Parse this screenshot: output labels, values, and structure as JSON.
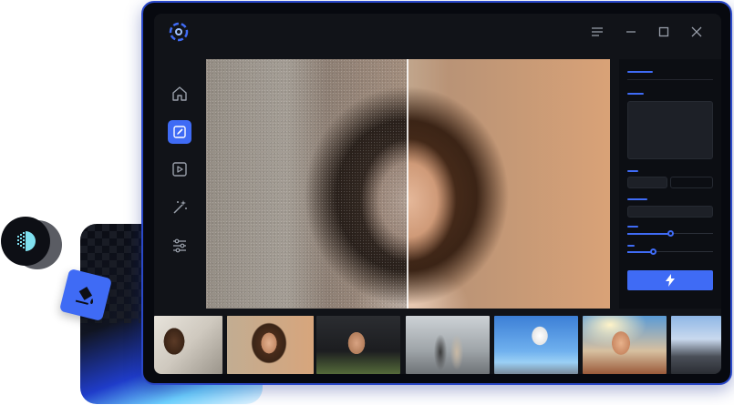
{
  "app": {
    "logo_icon": "aperture-logo-icon",
    "window_controls": [
      {
        "name": "menu-icon"
      },
      {
        "name": "minimize-icon"
      },
      {
        "name": "maximize-icon"
      },
      {
        "name": "close-icon"
      }
    ]
  },
  "sidebar": {
    "items": [
      {
        "icon": "home-icon",
        "active": false
      },
      {
        "icon": "edit-image-icon",
        "active": true
      },
      {
        "icon": "video-enhance-icon",
        "active": false
      },
      {
        "icon": "magic-wand-icon",
        "active": false
      },
      {
        "icon": "sliders-icon",
        "active": false
      }
    ]
  },
  "canvas": {
    "compare_split": 0.5
  },
  "panel": {
    "sliders": [
      {
        "value": 0.5
      },
      {
        "value": 0.3
      }
    ],
    "run_icon": "lightning-icon"
  },
  "thumbnails": [
    {
      "subject": "man-smiling",
      "selected": false
    },
    {
      "subject": "woman-curly-hair",
      "selected": true
    },
    {
      "subject": "young-man-portrait",
      "selected": false
    },
    {
      "subject": "couple-street",
      "selected": false
    },
    {
      "subject": "skateboarder-jump",
      "selected": false
    },
    {
      "subject": "woman-laughing-sunlight",
      "selected": false
    },
    {
      "subject": "city-street",
      "selected": false
    }
  ],
  "colors": {
    "accent": "#3f6bf5",
    "selection": "#f5c518",
    "window_bg": "#111318"
  }
}
